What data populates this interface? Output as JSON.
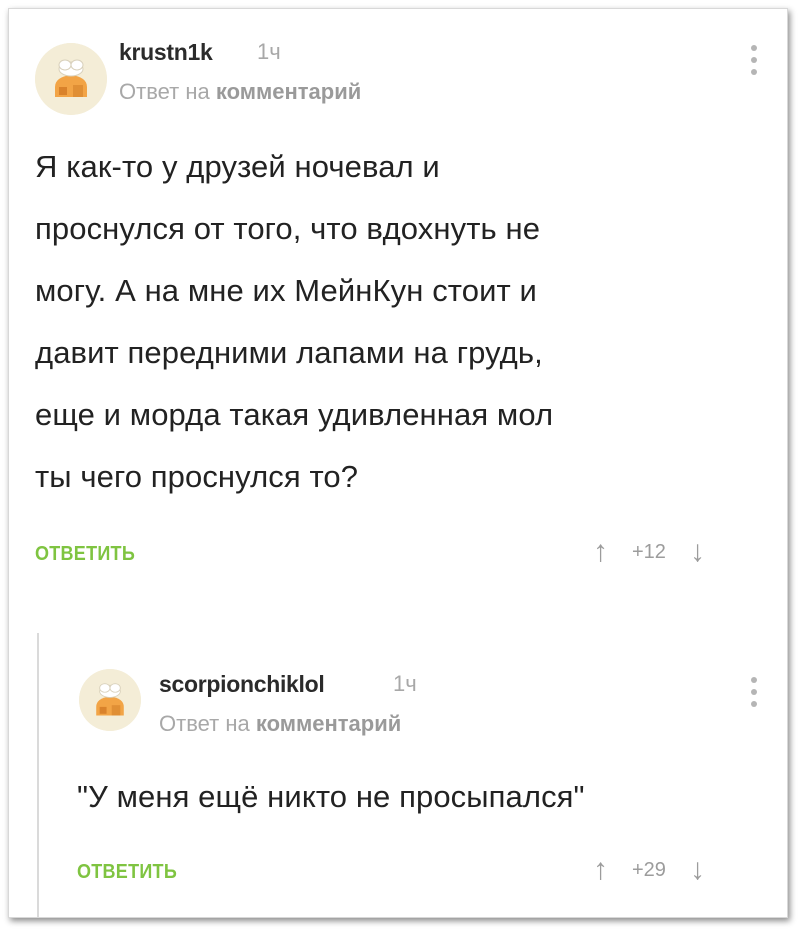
{
  "comment": {
    "username": "krustn1k",
    "time": "1ч",
    "reply_prefix": "Ответ на",
    "reply_target": "комментарий",
    "text_lines": [
      "Я как-то у друзей ночевал и",
      "проснулся от того, что вдохнуть не",
      "могу. А на мне их МейнКун стоит и",
      "давит передними лапами на грудь,",
      "еще и морда такая удивленная мол",
      "ты чего проснулся то?"
    ],
    "reply_label": "ОТВЕТИТЬ",
    "rating": "+12",
    "upvote_icon": "↑",
    "downvote_icon": "↓"
  },
  "reply": {
    "username": "scorpionchiklol",
    "time": "1ч",
    "reply_prefix": "Ответ на",
    "reply_target": "комментарий",
    "text": "\"У меня ещё никто не просыпался\"",
    "reply_label": "ОТВЕТИТЬ",
    "rating": "+29",
    "upvote_icon": "↑",
    "downvote_icon": "↓"
  },
  "colors": {
    "accent_green": "#7fc441",
    "muted_gray": "#a8a8a8",
    "text_dark": "#222222"
  }
}
